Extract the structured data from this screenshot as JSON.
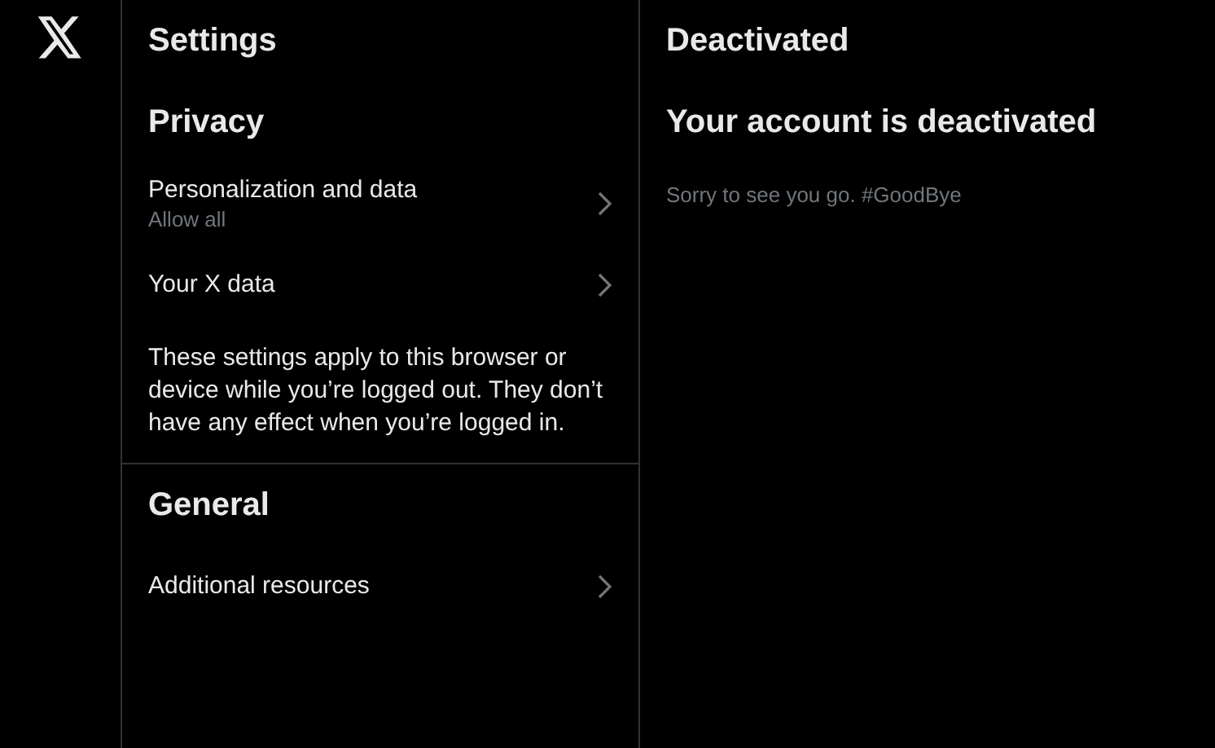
{
  "settings": {
    "title": "Settings",
    "sections": [
      {
        "title": "Privacy",
        "items": [
          {
            "label": "Personalization and data",
            "sublabel": "Allow all"
          },
          {
            "label": "Your X data"
          }
        ],
        "note": "These settings apply to this browser or device while you’re logged out. They don’t have any effect when you’re logged in."
      },
      {
        "title": "General",
        "items": [
          {
            "label": "Additional resources"
          }
        ]
      }
    ]
  },
  "detail": {
    "title": "Deactivated",
    "heading": "Your account is deactivated",
    "message": "Sorry to see you go. #GoodBye"
  }
}
